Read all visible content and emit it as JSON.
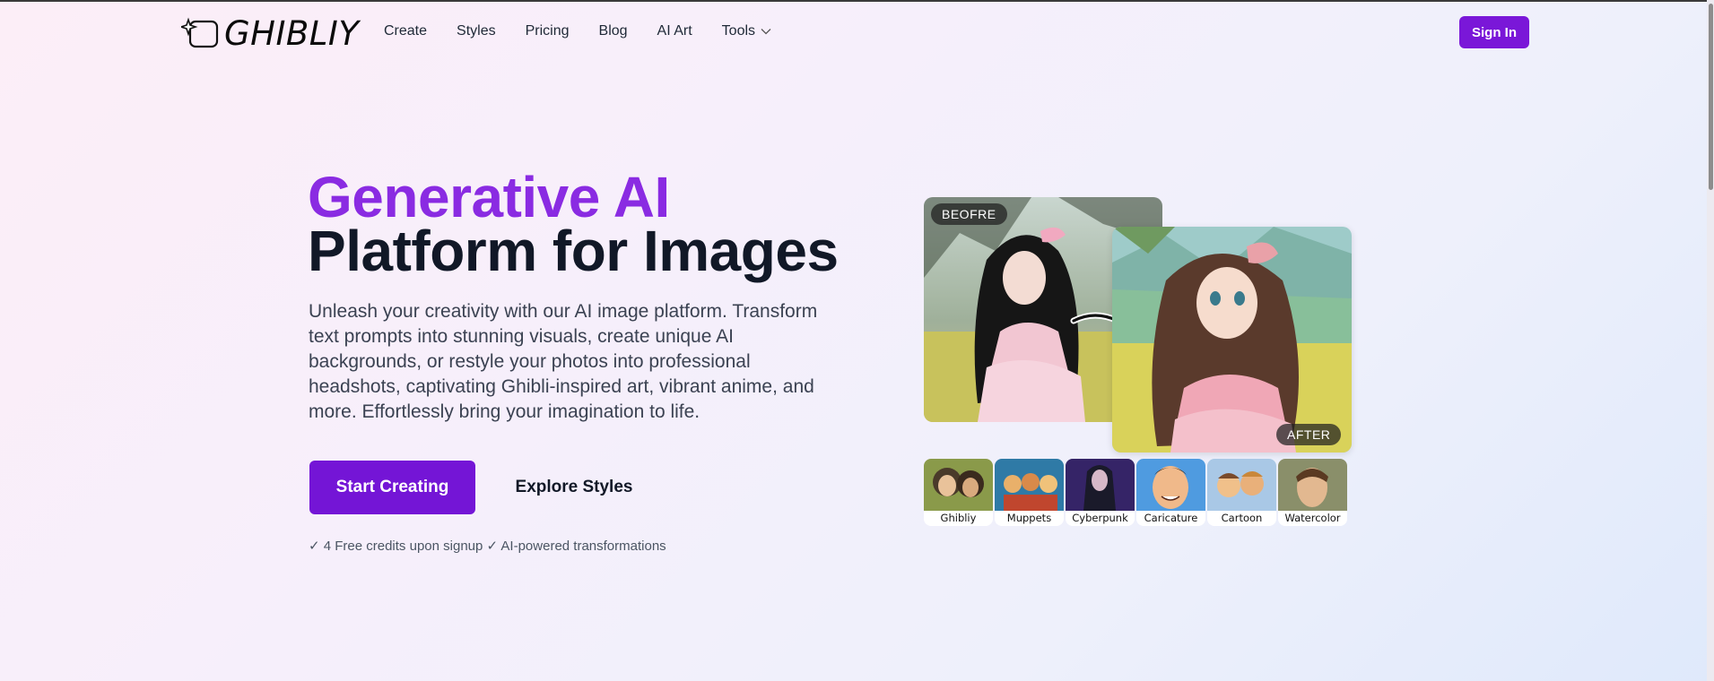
{
  "header": {
    "logo_text": "GHIBLIY",
    "nav": [
      {
        "label": "Create"
      },
      {
        "label": "Styles"
      },
      {
        "label": "Pricing"
      },
      {
        "label": "Blog"
      },
      {
        "label": "AI Art"
      },
      {
        "label": "Tools",
        "icon": "chevron-down-icon"
      }
    ],
    "signin_label": "Sign In"
  },
  "hero": {
    "title_line1": "Generative AI",
    "title_line2": "Platform for Images",
    "description": "Unleash your creativity with our AI image platform. Transform text prompts into stunning visuals, create unique AI backgrounds, or restyle your photos into professional headshots, captivating Ghibli-inspired art, vibrant anime, and more. Effortlessly bring your imagination to life.",
    "primary_cta": "Start Creating",
    "secondary_cta": "Explore Styles",
    "perks": "✓ 4 Free credits upon signup ✓ AI-powered transformations"
  },
  "showcase": {
    "before_label": "BEOFRE",
    "after_label": "AFTER",
    "styles": [
      {
        "label": "Ghibliy"
      },
      {
        "label": "Muppets"
      },
      {
        "label": "Cyberpunk"
      },
      {
        "label": "Caricature"
      },
      {
        "label": "Cartoon"
      },
      {
        "label": "Watercolor"
      }
    ]
  },
  "colors": {
    "accent": "#7a17d8",
    "title_accent": "#8a2be2"
  }
}
